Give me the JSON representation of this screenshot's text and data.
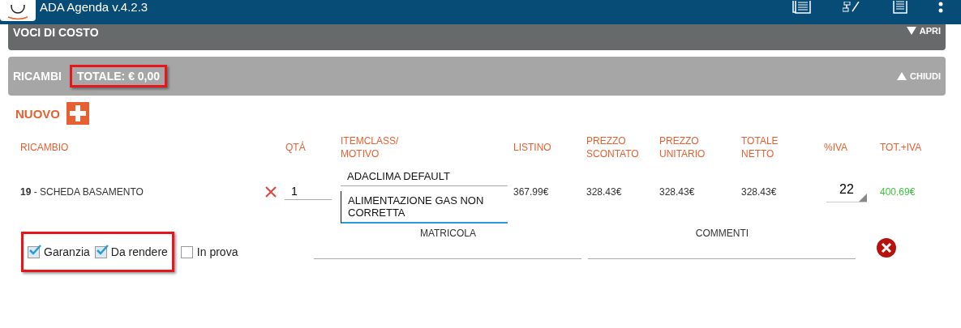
{
  "app_bar": {
    "title": "ADA Agenda v.4.2.3"
  },
  "sections": [
    {
      "title": "VOCI DI COSTO",
      "expanded": false,
      "toggle": "APRI"
    },
    {
      "title": "RICAMBI",
      "total": "TOTALE: € 0,00",
      "total_highlighted": true,
      "expanded": true,
      "toggle": "CHIUDI"
    }
  ],
  "new_button": "NUOVO",
  "table": {
    "columns": [
      "RICAMBIO",
      "QTÁ",
      "ITEMCLASS/\nMOTIVO",
      "LISTINO",
      "PREZZO\nSCONTATO",
      "PREZZO\nUNITARIO",
      "TOTALE\nNETTO",
      "%IVA",
      "TOT.+IVA"
    ],
    "rows": [
      {
        "code": "19",
        "name": " - SCHEDA BASAMENTO",
        "qty": "1",
        "itemclass": "ADACLIMA DEFAULT",
        "motivo": "ALIMENTAZIONE GAS NON CORRETTA",
        "listino": "367.99€",
        "prezzo_scontato": "328.43€",
        "prezzo_unitario": "328.43€",
        "totale_netto": "328.43€",
        "iva": "22",
        "tot_iva": "400.69€",
        "flags_highlighted": true,
        "flags": [
          {
            "label": "Garanzia",
            "checked": true
          },
          {
            "label": "Da rendere",
            "checked": true
          },
          {
            "label": "In prova",
            "checked": false
          }
        ],
        "matricola_label": "MATRICOLA",
        "commenti_label": "COMMENTI"
      }
    ]
  }
}
